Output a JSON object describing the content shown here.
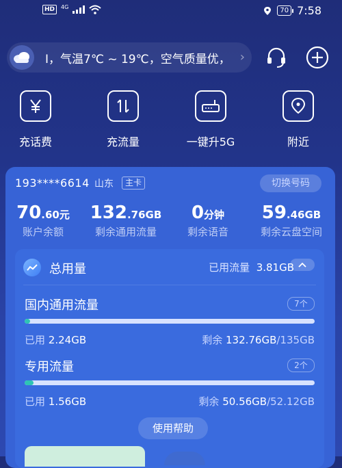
{
  "status_bar": {
    "network_badge": "HD",
    "signal_type": "4G",
    "battery": "70",
    "time": "7:58"
  },
  "header": {
    "weather_text": "I，气温7℃ ~ 19℃，空气质量优，",
    "weather_more": "›"
  },
  "quick_actions": [
    {
      "label": "充话费",
      "icon": "yuan-icon"
    },
    {
      "label": "充流量",
      "icon": "data-transfer-icon"
    },
    {
      "label": "一键升5G",
      "icon": "router-5g-icon"
    },
    {
      "label": "附近",
      "icon": "location-icon"
    }
  ],
  "account": {
    "phone": "193****6614",
    "province": "山东",
    "card_badge": "主卡",
    "switch_label": "切换号码",
    "stats": [
      {
        "value_main": "70",
        "value_small": ".60元",
        "label": "账户余额"
      },
      {
        "value_main": "132",
        "value_small": ".76GB",
        "label": "剩余通用流量"
      },
      {
        "value_main": "0",
        "value_small": "分钟",
        "label": "剩余语音"
      },
      {
        "value_main": "59",
        "value_small": ".46GB",
        "label": "剩余云盘空间"
      }
    ]
  },
  "usage": {
    "title": "总用量",
    "used_label": "已用流量",
    "used_value": "3.81GB",
    "sections": [
      {
        "title": "国内通用流量",
        "count": "7个",
        "progress": 0.02,
        "used_label": "已用",
        "used_value": "2.24GB",
        "remain_label": "剩余",
        "remain_value": "132.76GB",
        "total": "/135GB"
      },
      {
        "title": "专用流量",
        "count": "2个",
        "progress": 0.03,
        "used_label": "已用",
        "used_value": "1.56GB",
        "remain_label": "剩余",
        "remain_value": "50.56GB",
        "total": "/52.12GB"
      }
    ],
    "help_label": "使用帮助"
  },
  "colors": {
    "background_top": "#1f2d79",
    "card": "#3763d6",
    "usage_panel": "#3a6bde",
    "progress_fill": "#2ec3b4",
    "progress_track": "#d7e2ff"
  }
}
